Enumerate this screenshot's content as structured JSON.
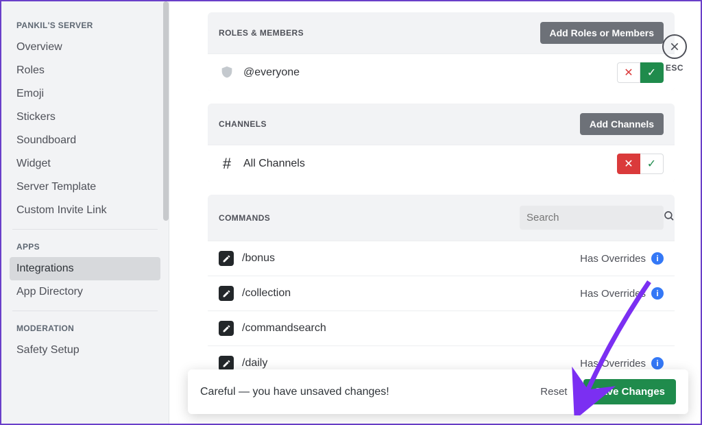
{
  "sidebar": {
    "section1_title": "PANKIL'S SERVER",
    "items1": [
      "Overview",
      "Roles",
      "Emoji",
      "Stickers",
      "Soundboard",
      "Widget",
      "Server Template",
      "Custom Invite Link"
    ],
    "section2_title": "APPS",
    "items2": [
      "Integrations",
      "App Directory"
    ],
    "active2_index": 0,
    "section3_title": "MODERATION",
    "items3": [
      "Safety Setup"
    ]
  },
  "roles_panel": {
    "title": "ROLES & MEMBERS",
    "add_button": "Add Roles or Members",
    "row_label": "@everyone"
  },
  "channels_panel": {
    "title": "CHANNELS",
    "add_button": "Add Channels",
    "row_label": "All Channels"
  },
  "commands_panel": {
    "title": "COMMANDS",
    "search_placeholder": "Search",
    "override_label": "Has Overrides",
    "commands": [
      {
        "name": "/bonus",
        "overrides": true
      },
      {
        "name": "/collection",
        "overrides": true
      },
      {
        "name": "/commandsearch",
        "overrides": false
      },
      {
        "name": "/daily",
        "overrides": true
      }
    ]
  },
  "unsaved_bar": {
    "message": "Careful — you have unsaved changes!",
    "reset": "Reset",
    "save": "Save Changes"
  },
  "esc_label": "ESC"
}
